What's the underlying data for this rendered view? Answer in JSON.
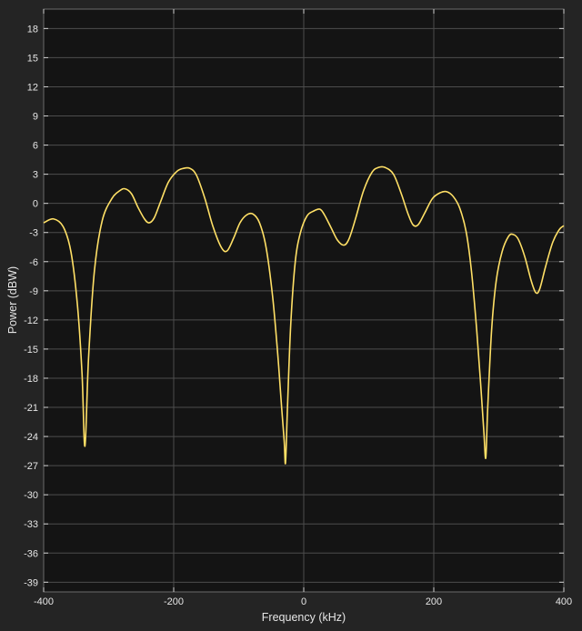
{
  "chart_data": {
    "type": "line",
    "title": "",
    "xlabel": "Frequency (kHz)",
    "ylabel": "Power (dBW)",
    "xlim": [
      -400,
      400
    ],
    "ylim": [
      -40,
      20
    ],
    "grid": true,
    "x_ticks": [
      -400,
      -200,
      0,
      200,
      400
    ],
    "y_ticks": [
      18,
      15,
      12,
      9,
      6,
      3,
      0,
      -3,
      -6,
      -9,
      -12,
      -15,
      -18,
      -21,
      -24,
      -27,
      -30,
      -33,
      -36,
      -39
    ],
    "colors": {
      "background": "#242424",
      "plot_area": "#141414",
      "grid": "#4d4d4d",
      "line": "#ffe066",
      "text": "#e6e6e6"
    },
    "series": [
      {
        "color": "#ffe066",
        "points": [
          [
            -400,
            -2.0
          ],
          [
            -385,
            -1.6
          ],
          [
            -370,
            -2.4
          ],
          [
            -358,
            -5.0
          ],
          [
            -348,
            -10.5
          ],
          [
            -341,
            -17.5
          ],
          [
            -336.5,
            -25.0
          ],
          [
            -331,
            -16.0
          ],
          [
            -322,
            -7.0
          ],
          [
            -310,
            -1.8
          ],
          [
            -295,
            0.5
          ],
          [
            -283,
            1.3
          ],
          [
            -275,
            1.5
          ],
          [
            -265,
            1.0
          ],
          [
            -255,
            -0.4
          ],
          [
            -245,
            -1.6
          ],
          [
            -238,
            -2.0
          ],
          [
            -230,
            -1.5
          ],
          [
            -220,
            0.2
          ],
          [
            -208,
            2.2
          ],
          [
            -195,
            3.3
          ],
          [
            -185,
            3.6
          ],
          [
            -175,
            3.6
          ],
          [
            -165,
            2.9
          ],
          [
            -152,
            0.5
          ],
          [
            -140,
            -2.3
          ],
          [
            -127,
            -4.5
          ],
          [
            -118,
            -4.9
          ],
          [
            -108,
            -3.6
          ],
          [
            -98,
            -2.0
          ],
          [
            -88,
            -1.2
          ],
          [
            -78,
            -1.1
          ],
          [
            -68,
            -2.0
          ],
          [
            -58,
            -4.5
          ],
          [
            -48,
            -9.5
          ],
          [
            -40,
            -15.5
          ],
          [
            -34,
            -21.0
          ],
          [
            -30,
            -24.5
          ],
          [
            -28,
            -26.7
          ],
          [
            -25,
            -21.0
          ],
          [
            -20,
            -12.5
          ],
          [
            -13,
            -6.0
          ],
          [
            -5,
            -3.0
          ],
          [
            5,
            -1.3
          ],
          [
            15,
            -0.8
          ],
          [
            25,
            -0.6
          ],
          [
            32,
            -1.2
          ],
          [
            42,
            -2.5
          ],
          [
            52,
            -3.8
          ],
          [
            62,
            -4.3
          ],
          [
            70,
            -3.6
          ],
          [
            80,
            -1.5
          ],
          [
            92,
            1.3
          ],
          [
            105,
            3.2
          ],
          [
            115,
            3.7
          ],
          [
            125,
            3.7
          ],
          [
            138,
            3.0
          ],
          [
            150,
            1.0
          ],
          [
            160,
            -1.0
          ],
          [
            168,
            -2.2
          ],
          [
            176,
            -2.2
          ],
          [
            186,
            -1.0
          ],
          [
            198,
            0.5
          ],
          [
            210,
            1.1
          ],
          [
            220,
            1.2
          ],
          [
            230,
            0.7
          ],
          [
            240,
            -0.5
          ],
          [
            250,
            -3.0
          ],
          [
            258,
            -7.0
          ],
          [
            266,
            -13.0
          ],
          [
            272,
            -18.5
          ],
          [
            277,
            -23.5
          ],
          [
            280,
            -26.2
          ],
          [
            283,
            -21.0
          ],
          [
            289,
            -13.0
          ],
          [
            296,
            -8.0
          ],
          [
            305,
            -5.0
          ],
          [
            315,
            -3.4
          ],
          [
            322,
            -3.2
          ],
          [
            330,
            -3.7
          ],
          [
            340,
            -5.5
          ],
          [
            350,
            -8.0
          ],
          [
            357,
            -9.2
          ],
          [
            363,
            -8.8
          ],
          [
            372,
            -6.5
          ],
          [
            383,
            -4.0
          ],
          [
            393,
            -2.7
          ],
          [
            400,
            -2.3
          ]
        ]
      }
    ]
  }
}
